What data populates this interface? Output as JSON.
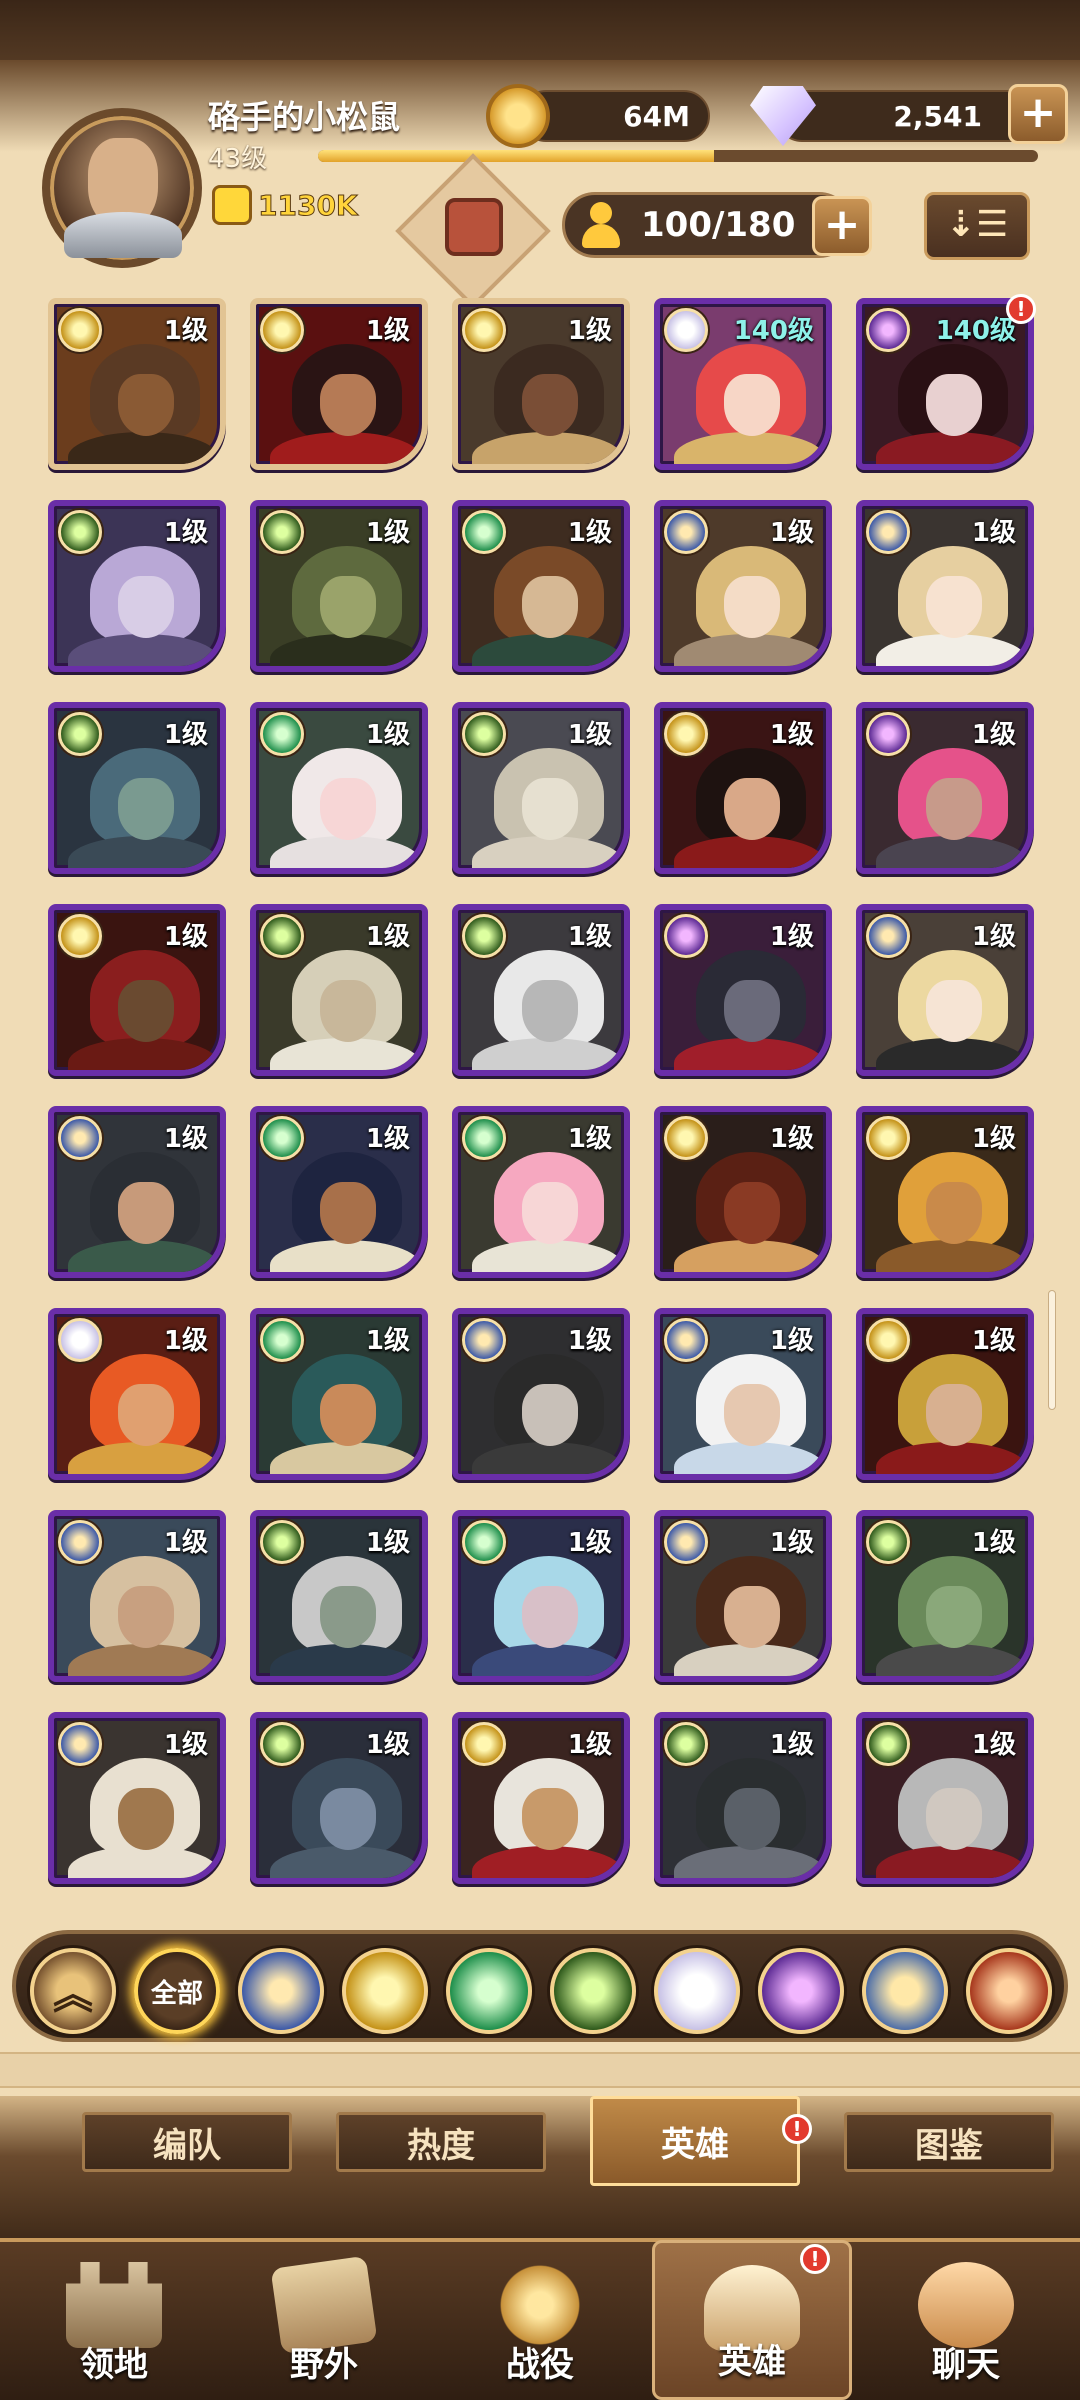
{
  "player": {
    "name": "硌手的小松鼠",
    "level": "43级",
    "power": "1130K",
    "xp_fraction": 0.55
  },
  "resources": {
    "gold": "64M",
    "diamonds": "2,541",
    "plus": "+"
  },
  "roster": {
    "capacity": "100/180",
    "plus": "+",
    "sort_icon": "sort-icon"
  },
  "heroes": [
    {
      "level": "1级",
      "faction": "lb",
      "frame": "gold",
      "hair": "#5a3a24",
      "face": "#8a5a34",
      "bg": "#6b3d1d",
      "body": "#3a2818"
    },
    {
      "level": "1级",
      "faction": "lb",
      "frame": "gold",
      "hair": "#2a1414",
      "face": "#b57a55",
      "bg": "#5a1010",
      "body": "#a01c1c"
    },
    {
      "level": "1级",
      "faction": "lb",
      "frame": "gold",
      "hair": "#3b2a20",
      "face": "#7a4e36",
      "bg": "#4a3a2c",
      "body": "#c7a36a"
    },
    {
      "level": "140级",
      "faction": "cel",
      "frame": "purple",
      "hair": "#e64a4a",
      "face": "#f7d6c6",
      "bg": "#7a3c6e",
      "body": "#d9b46a",
      "high": true
    },
    {
      "level": "140级",
      "faction": "hell",
      "frame": "purple",
      "hair": "#2a1014",
      "face": "#e8d0d0",
      "bg": "#3a1a24",
      "body": "#8a1a22",
      "high": true,
      "badge": "!"
    },
    {
      "level": "1级",
      "faction": "grave",
      "frame": "purple",
      "hair": "#b9a8d6",
      "face": "#d8cde6",
      "bg": "#3c3456",
      "body": "#5a4e7a"
    },
    {
      "level": "1级",
      "faction": "grave",
      "frame": "purple",
      "hair": "#5e6a3e",
      "face": "#9aa36a",
      "bg": "#3a3e26",
      "body": "#2a2e1c"
    },
    {
      "level": "1级",
      "faction": "wild",
      "frame": "purple",
      "hair": "#7a4a28",
      "face": "#d6b894",
      "bg": "#3e2c20",
      "body": "#2c4a3c"
    },
    {
      "level": "1级",
      "faction": "fort",
      "frame": "purple",
      "hair": "#d9b978",
      "face": "#f4dcc6",
      "bg": "#4e3a2a",
      "body": "#a08a72"
    },
    {
      "level": "1级",
      "faction": "fort",
      "frame": "purple",
      "hair": "#e6cfa0",
      "face": "#f7e2d0",
      "bg": "#3a3430",
      "body": "#f2eee6"
    },
    {
      "level": "1级",
      "faction": "grave",
      "frame": "purple",
      "hair": "#4a6a7a",
      "face": "#7a9a90",
      "bg": "#2a3440",
      "body": "#3a4a56"
    },
    {
      "level": "1级",
      "faction": "wild",
      "frame": "purple",
      "hair": "#f0e8e8",
      "face": "#f7d6d6",
      "bg": "#3a4a40",
      "body": "#e6e0e0"
    },
    {
      "level": "1级",
      "faction": "grave",
      "frame": "purple",
      "hair": "#c9c2b0",
      "face": "#e6e0d0",
      "bg": "#4a4a52",
      "body": "#d8d0c0"
    },
    {
      "level": "1级",
      "faction": "lb",
      "frame": "purple",
      "hair": "#1e1210",
      "face": "#d9a888",
      "bg": "#3a1414",
      "body": "#8a1a1a"
    },
    {
      "level": "1级",
      "faction": "hell",
      "frame": "purple",
      "hair": "#e5528a",
      "face": "#c79a8a",
      "bg": "#3a2a30",
      "body": "#4a4450"
    },
    {
      "level": "1级",
      "faction": "lb",
      "frame": "purple",
      "hair": "#8a1e1e",
      "face": "#6a4a30",
      "bg": "#3a1410",
      "body": "#6a1a14"
    },
    {
      "level": "1级",
      "faction": "grave",
      "frame": "purple",
      "hair": "#d6cfb8",
      "face": "#c8b79a",
      "bg": "#3a3a2a",
      "body": "#e8e4d6"
    },
    {
      "level": "1级",
      "faction": "grave",
      "frame": "purple",
      "hair": "#e8e8e8",
      "face": "#b7b7b7",
      "bg": "#3c3a3e",
      "body": "#cfcfcf"
    },
    {
      "level": "1级",
      "faction": "hell",
      "frame": "purple",
      "hair": "#2a2a36",
      "face": "#6a6a7a",
      "bg": "#3a1e3a",
      "body": "#a01e2a"
    },
    {
      "level": "1级",
      "faction": "fort",
      "frame": "purple",
      "hair": "#ecd8a0",
      "face": "#f6e4d4",
      "bg": "#4a4038",
      "body": "#2a2a2a"
    },
    {
      "level": "1级",
      "faction": "fort",
      "frame": "purple",
      "hair": "#2a2e34",
      "face": "#c79a7a",
      "bg": "#30343a",
      "body": "#3a5a4a"
    },
    {
      "level": "1级",
      "faction": "wild",
      "frame": "purple",
      "hair": "#1e2440",
      "face": "#a8704a",
      "bg": "#2a2e4a",
      "body": "#e8e0c8"
    },
    {
      "level": "1级",
      "faction": "wild",
      "frame": "purple",
      "hair": "#f6a8c0",
      "face": "#f7d6d6",
      "bg": "#3a3a30",
      "body": "#e8e4d6"
    },
    {
      "level": "1级",
      "faction": "lb",
      "frame": "purple",
      "hair": "#5a2014",
      "face": "#8a3a24",
      "bg": "#2a1e1a",
      "body": "#d6a060"
    },
    {
      "level": "1级",
      "faction": "lb",
      "frame": "purple",
      "hair": "#e0a03a",
      "face": "#c98a4a",
      "bg": "#3a2a1a",
      "body": "#8a5a2a"
    },
    {
      "level": "1级",
      "faction": "cel",
      "frame": "purple",
      "hair": "#e85a24",
      "face": "#e0a070",
      "bg": "#5a1e14",
      "body": "#d8a040"
    },
    {
      "level": "1级",
      "faction": "wild",
      "frame": "purple",
      "hair": "#2a5a5a",
      "face": "#c98a5a",
      "bg": "#2a3a34",
      "body": "#d8c8a0"
    },
    {
      "level": "1级",
      "faction": "fort",
      "frame": "purple",
      "hair": "#2a2a2a",
      "face": "#c8c0b8",
      "bg": "#2e2e30",
      "body": "#3a3a3a"
    },
    {
      "level": "1级",
      "faction": "fort",
      "frame": "purple",
      "hair": "#f2f2f2",
      "face": "#e6c8b0",
      "bg": "#3a4a5a",
      "body": "#c8d8e8"
    },
    {
      "level": "1级",
      "faction": "lb",
      "frame": "purple",
      "hair": "#c8a03a",
      "face": "#d8b090",
      "bg": "#3a1410",
      "body": "#8a1a1a"
    },
    {
      "level": "1级",
      "faction": "fort",
      "frame": "purple",
      "hair": "#d6c0a0",
      "face": "#c8a080",
      "bg": "#3a4a5a",
      "body": "#a07a54"
    },
    {
      "level": "1级",
      "faction": "grave",
      "frame": "purple",
      "hair": "#c8c8c8",
      "face": "#8a9a8a",
      "bg": "#2a343a",
      "body": "#2a3a4a"
    },
    {
      "level": "1级",
      "faction": "wild",
      "frame": "purple",
      "hair": "#a8d8e8",
      "face": "#d8c0c8",
      "bg": "#2a2e4a",
      "body": "#3a4a7a"
    },
    {
      "level": "1级",
      "faction": "fort",
      "frame": "purple",
      "hair": "#4a2a1a",
      "face": "#d8b090",
      "bg": "#3a3a3a",
      "body": "#d8d0c0"
    },
    {
      "level": "1级",
      "faction": "grave",
      "frame": "purple",
      "hair": "#6a8a5a",
      "face": "#8aa87a",
      "bg": "#2a342a",
      "body": "#4a4a4a"
    },
    {
      "level": "1级",
      "faction": "fort",
      "frame": "purple",
      "hair": "#e8e0d0",
      "face": "#a0784e",
      "bg": "#3a3430",
      "body": "#e8e0d0"
    },
    {
      "level": "1级",
      "faction": "grave",
      "frame": "purple",
      "hair": "#3a4a5a",
      "face": "#7a8aa0",
      "bg": "#2a2e3a",
      "body": "#4a5a6a"
    },
    {
      "level": "1级",
      "faction": "lb",
      "frame": "purple",
      "hair": "#e8e4dc",
      "face": "#c89a6a",
      "bg": "#3a2420",
      "body": "#a01e24"
    },
    {
      "level": "1级",
      "faction": "grave",
      "frame": "purple",
      "hair": "#2a2e30",
      "face": "#5a6068",
      "bg": "#2e3036",
      "body": "#6a6e78"
    },
    {
      "level": "1级",
      "faction": "grave",
      "frame": "purple",
      "hair": "#b8b8b8",
      "face": "#d0c8c0",
      "bg": "#3a1e24",
      "body": "#8a1a22"
    }
  ],
  "filters": {
    "up_label": "︽",
    "all_label": "全部",
    "items": [
      "fortress-icon",
      "lightbearer-icon",
      "wilder-icon",
      "graveborn-icon",
      "celestial-icon",
      "hypogean-icon",
      "dimensional-icon",
      "dragon-icon"
    ]
  },
  "subtabs": [
    "编队",
    "热度",
    "英雄",
    "图鉴"
  ],
  "subtab_badge": "!",
  "nav": [
    "领地",
    "野外",
    "战役",
    "英雄",
    "聊天"
  ],
  "nav_badge": "!"
}
